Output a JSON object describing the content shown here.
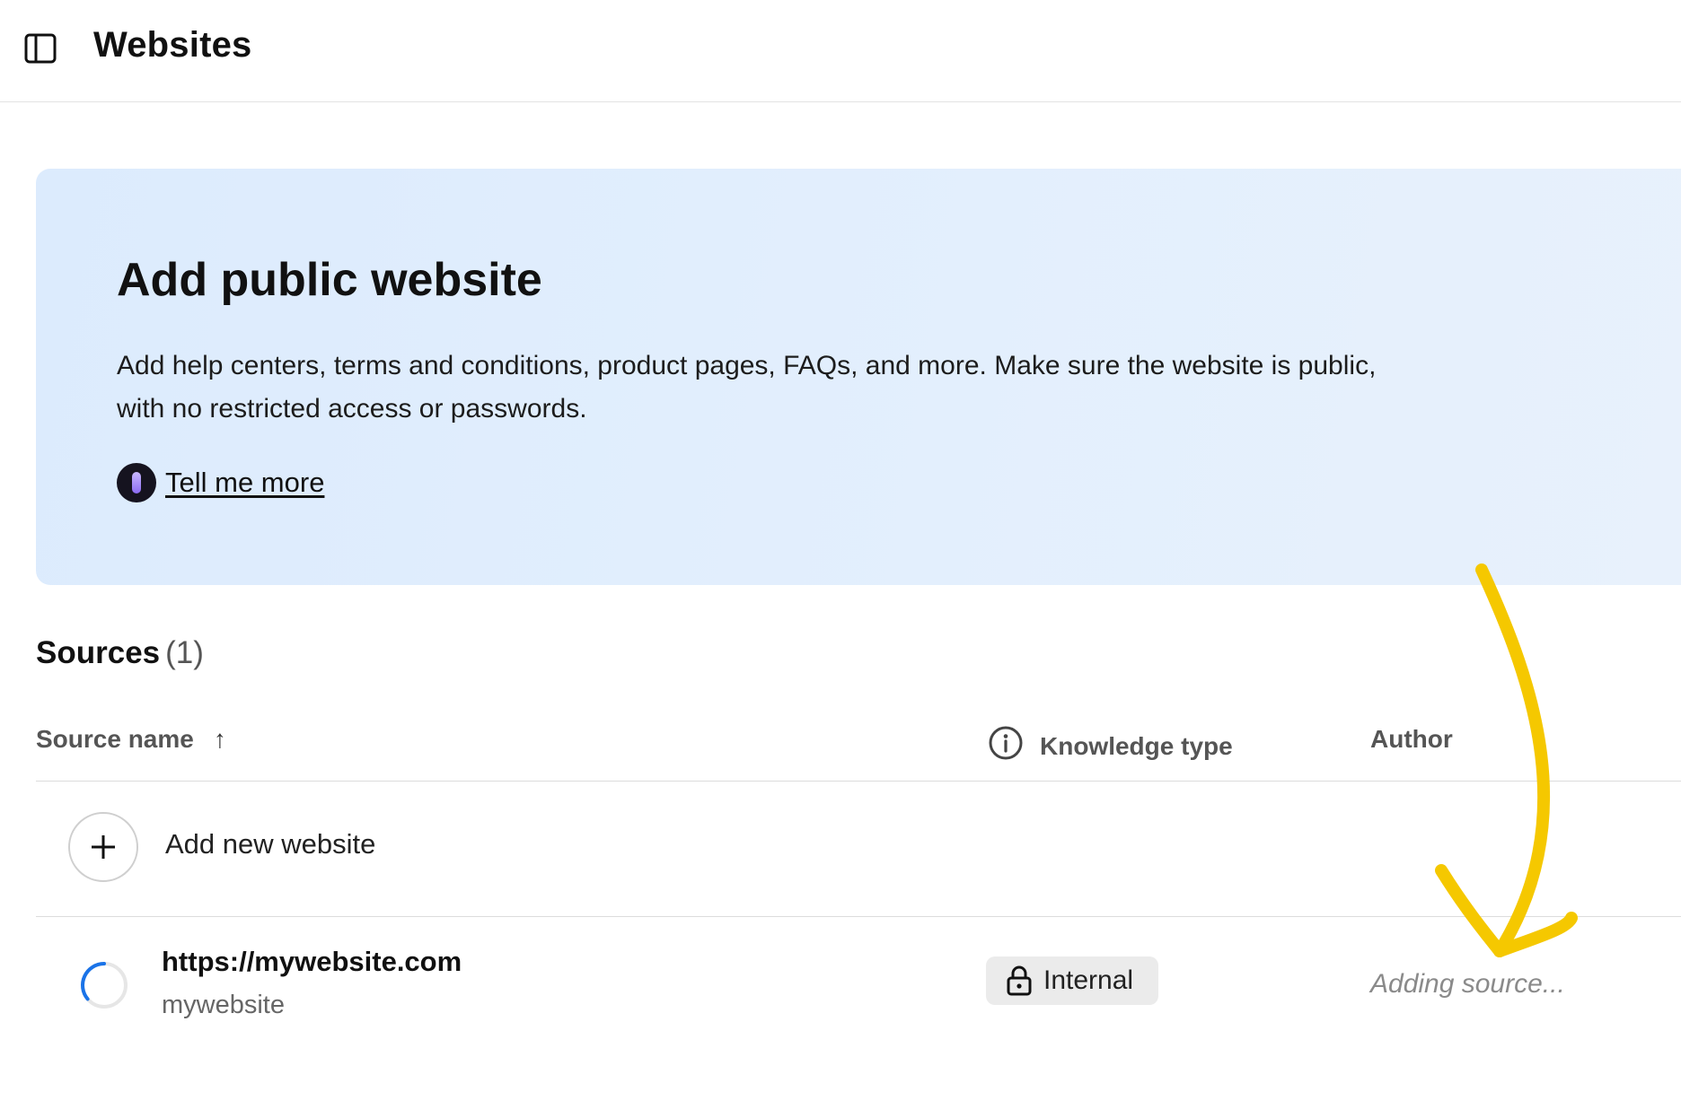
{
  "header": {
    "title": "Websites",
    "sidebar_toggle_icon": "sidebar-panel-icon"
  },
  "banner": {
    "title": "Add public website",
    "description": "Add help centers, terms and conditions, product pages, FAQs, and more. Make sure the website is public, with no restricted access or passwords.",
    "link_label": "Tell me more",
    "link_icon": "assistant-icon",
    "background": "#dcebfd"
  },
  "sources": {
    "heading": "Sources",
    "count": "(1)",
    "columns": {
      "source_name": "Source name",
      "sort_indicator": "↑",
      "knowledge_type": "Knowledge type",
      "author": "Author"
    },
    "add_row": {
      "label": "Add new website",
      "icon": "plus-icon"
    },
    "rows": [
      {
        "url": "https://mywebsite.com",
        "name": "mywebsite",
        "knowledge_type": "Internal",
        "knowledge_type_icon": "lock-icon",
        "status": "Adding source...",
        "status_icon": "loading-spinner-icon"
      }
    ]
  },
  "annotation": {
    "type": "hand-drawn-arrow",
    "color": "#f5c800"
  }
}
